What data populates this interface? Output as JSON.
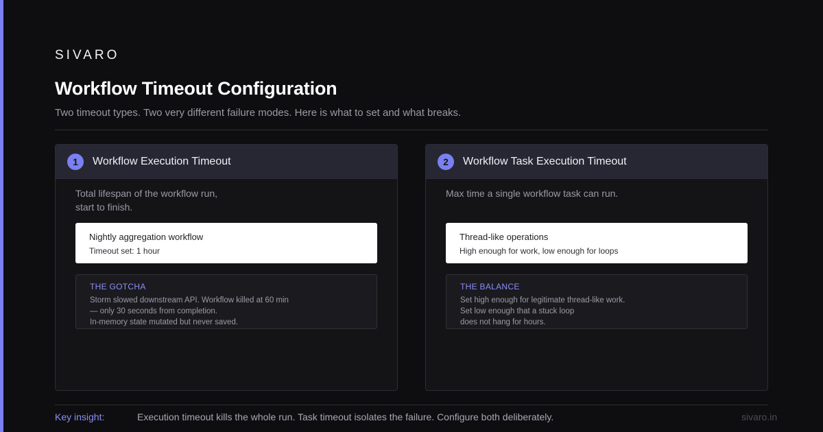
{
  "brand": "SIVARO",
  "title": "Workflow Timeout Configuration",
  "subtitle": "Two timeout types. Two very different failure modes. Here is what to set and what breaks.",
  "accent_color": "#7b80f0",
  "cards": [
    {
      "number": "1",
      "title": "Workflow Execution Timeout",
      "description_lines": [
        "Total lifespan of the workflow run,",
        "start to finish."
      ],
      "example": {
        "title": "Nightly aggregation workflow",
        "detail": "Timeout set: 1 hour"
      },
      "note": {
        "label": "THE GOTCHA",
        "lines": [
          "Storm slowed downstream API. Workflow killed at 60 min",
          "— only 30 seconds from completion.",
          "In-memory state mutated but never saved."
        ]
      }
    },
    {
      "number": "2",
      "title": "Workflow Task Execution Timeout",
      "description_lines": [
        "Max time a single workflow task can run."
      ],
      "example": {
        "title": "Thread-like operations",
        "detail": "High enough for work, low enough for loops"
      },
      "note": {
        "label": "THE BALANCE",
        "lines": [
          "Set high enough for legitimate thread-like work.",
          "Set low enough that a stuck loop",
          "does not hang for hours."
        ]
      }
    }
  ],
  "footer": {
    "insight_label": "Key insight:",
    "insight_text": "Execution timeout kills the whole run. Task timeout isolates the failure. Configure both deliberately.",
    "url": "sivaro.in"
  }
}
